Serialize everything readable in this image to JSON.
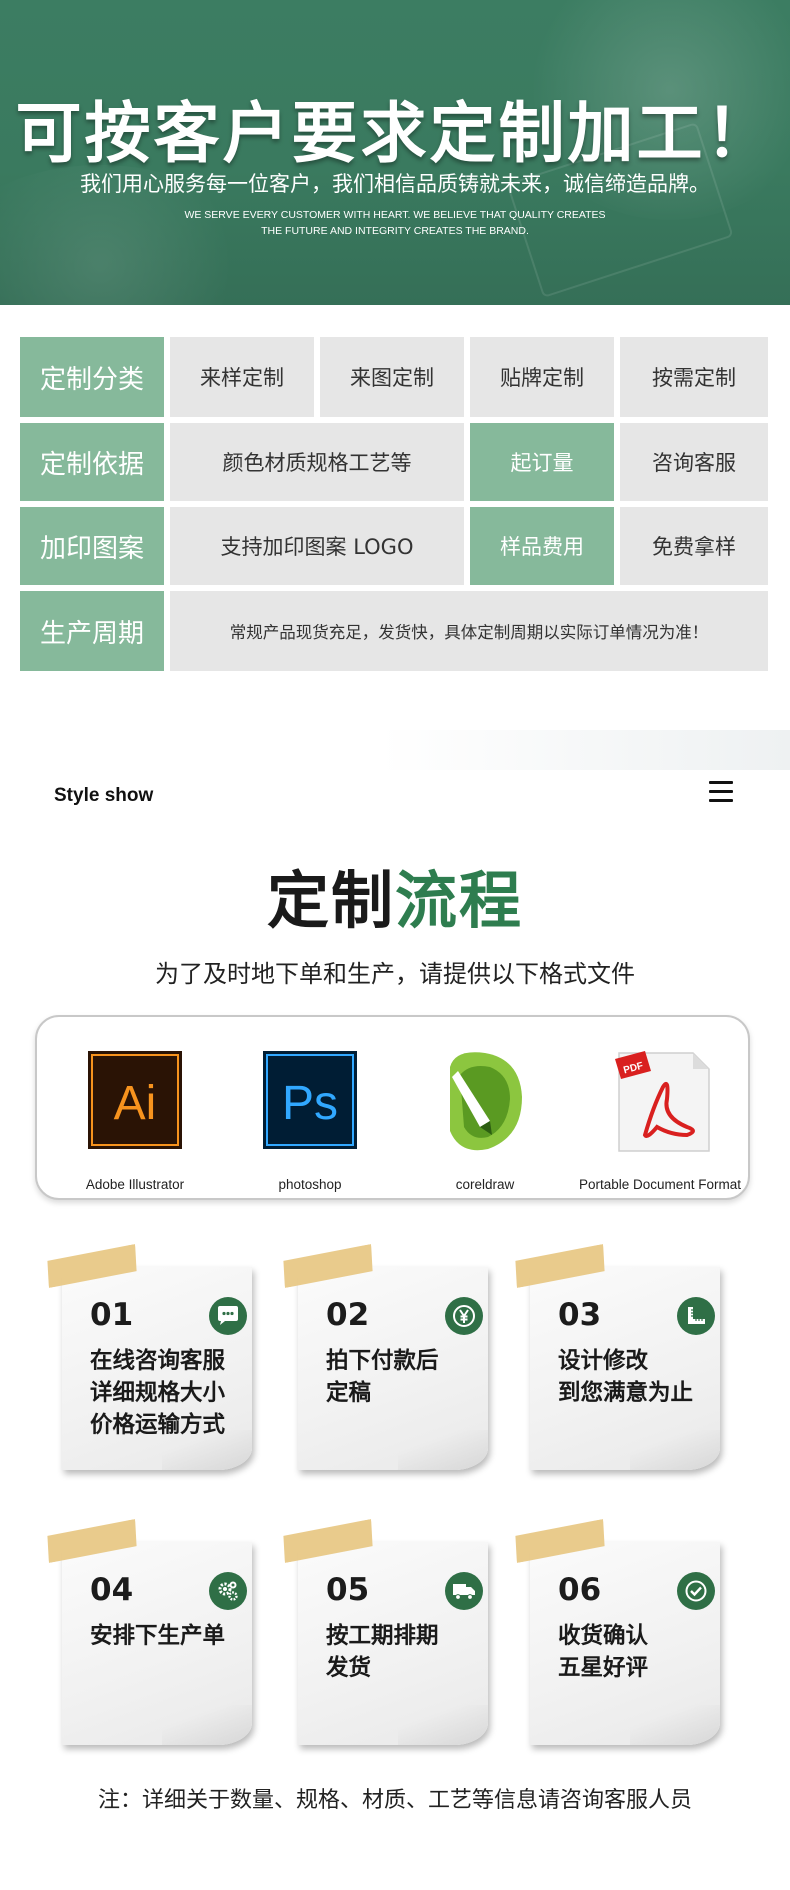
{
  "banner": {
    "title": "可按客户要求定制加工！",
    "subtitle": "我们用心服务每一位客户，我们相信品质铸就未来，诚信缔造品牌。",
    "english_line1": "WE SERVE EVERY CUSTOMER WITH HEART. WE BELIEVE THAT QUALITY CREATES",
    "english_line2": "THE FUTURE AND INTEGRITY CREATES THE BRAND."
  },
  "table": {
    "rows": [
      {
        "header": "定制分类",
        "cells": [
          "来样定制",
          "来图定制",
          "贴牌定制",
          "按需定制"
        ]
      },
      {
        "header": "定制依据",
        "cells": [
          "颜色材质规格工艺等",
          "起订量",
          "咨询客服"
        ]
      },
      {
        "header": "加印图案",
        "cells": [
          "支持加印图案 LOGO",
          "样品费用",
          "免费拿样"
        ]
      },
      {
        "header": "生产周期",
        "cells": [
          "常规产品现货充足，发货快，具体定制周期以实际订单情况为准！"
        ]
      }
    ],
    "colors": {
      "header_green": "#86b99b",
      "cell_gray": "#e6e6e6"
    }
  },
  "style_show": {
    "label": "Style show",
    "menu_icon": "hamburger-menu-icon"
  },
  "flow": {
    "title_part1": "定制",
    "title_part2": "流程",
    "subtitle": "为了及时地下单和生产，请提供以下格式文件",
    "title_accent_color": "#2e7d4f"
  },
  "formats": [
    {
      "icon": "adobe-illustrator-icon",
      "icon_text": "Ai",
      "label": "Adobe Illustrator"
    },
    {
      "icon": "photoshop-icon",
      "icon_text": "Ps",
      "label": "photoshop"
    },
    {
      "icon": "coreldraw-icon",
      "icon_text": "",
      "label": "coreldraw"
    },
    {
      "icon": "pdf-icon",
      "icon_text": "PDF",
      "label": "Portable Document Format"
    }
  ],
  "steps": [
    {
      "num": "01",
      "icon": "chat-icon",
      "text": "在线咨询客服\n详细规格大小\n价格运输方式"
    },
    {
      "num": "02",
      "icon": "yen-icon",
      "text": "拍下付款后\n定稿"
    },
    {
      "num": "03",
      "icon": "ruler-icon",
      "text": "设计修改\n到您满意为止"
    },
    {
      "num": "04",
      "icon": "gears-icon",
      "text": "安排下生产单"
    },
    {
      "num": "05",
      "icon": "truck-icon",
      "text": "按工期排期\n发货"
    },
    {
      "num": "06",
      "icon": "checkmark-icon",
      "text": "收货确认\n五星好评"
    }
  ],
  "footer_note": "注：详细关于数量、规格、材质、工艺等信息请咨询客服人员"
}
